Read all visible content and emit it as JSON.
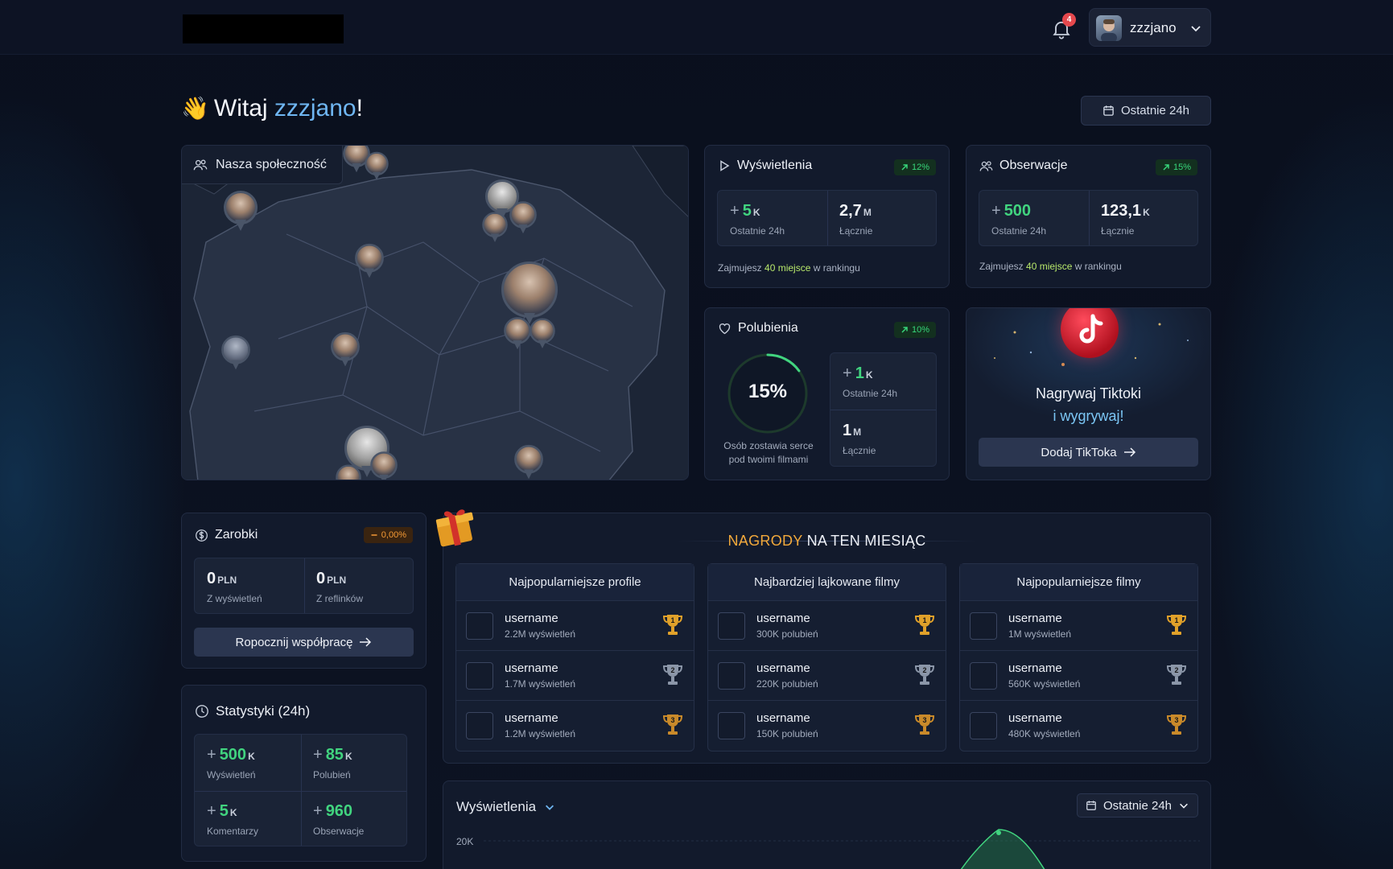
{
  "header": {
    "notification_count": "4",
    "user_name": "zzzjano"
  },
  "welcome": {
    "greeting": "Witaj",
    "name": "zzzjano",
    "suffix": "!",
    "emoji": "👋"
  },
  "range_button": "Ostatnie 24h",
  "community": {
    "title": "Nasza społeczność"
  },
  "views_card": {
    "title": "Wyświetlenia",
    "trend": "12%",
    "last24_value": "5",
    "last24_unit": "K",
    "last24_label": "Ostatnie 24h",
    "total_value": "2,7",
    "total_unit": "M",
    "total_label": "Łącznie",
    "rank_prefix": "Zajmujesz",
    "rank_place": "40 miejsce",
    "rank_suffix": "w rankingu"
  },
  "followers_card": {
    "title": "Obserwacje",
    "trend": "15%",
    "last24_value": "500",
    "last24_label": "Ostatnie 24h",
    "total_value": "123,1",
    "total_unit": "K",
    "total_label": "Łącznie",
    "rank_prefix": "Zajmujesz",
    "rank_place": "40 miejsce",
    "rank_suffix": "w rankingu"
  },
  "likes_card": {
    "title": "Polubienia",
    "trend": "10%",
    "ring_percent": "15%",
    "ring_fraction": 0.15,
    "ring_caption": "Osób zostawia serce pod twoimi filmami",
    "last24_value": "1",
    "last24_unit": "K",
    "last24_label": "Ostatnie 24h",
    "total_value": "1",
    "total_unit": "M",
    "total_label": "Łącznie"
  },
  "tiktok_card": {
    "line1": "Nagrywaj Tiktoki",
    "line2": "i wygrywaj!",
    "button": "Dodaj TikToka"
  },
  "earnings": {
    "title": "Zarobki",
    "trend": "0,00%",
    "views_value": "0",
    "views_unit": "PLN",
    "views_label": "Z wyświetleń",
    "reflinks_value": "0",
    "reflinks_unit": "PLN",
    "reflinks_label": "Z reflinków",
    "button": "Ropocznij współpracę"
  },
  "stats24": {
    "title": "Statystyki (24h)",
    "views_value": "500",
    "views_unit": "K",
    "views_label": "Wyświetleń",
    "likes_value": "85",
    "likes_unit": "K",
    "likes_label": "Polubień",
    "comments_value": "5",
    "comments_unit": "K",
    "comments_label": "Komentarzy",
    "followers_value": "960",
    "followers_label": "Obserwacje"
  },
  "prizes": {
    "title_highlight": "NAGRODY",
    "title_rest": "NA TEN MIESIĄC",
    "columns": [
      {
        "title": "Najpopularniejsze profile",
        "rows": [
          {
            "name": "username",
            "sub": "2.2M wyświetleń",
            "place": "1"
          },
          {
            "name": "username",
            "sub": "1.7M wyświetleń",
            "place": "2"
          },
          {
            "name": "username",
            "sub": "1.2M wyświetleń",
            "place": "3"
          }
        ]
      },
      {
        "title": "Najbardziej lajkowane filmy",
        "rows": [
          {
            "name": "username",
            "sub": "300K polubień",
            "place": "1"
          },
          {
            "name": "username",
            "sub": "220K polubień",
            "place": "2"
          },
          {
            "name": "username",
            "sub": "150K polubień",
            "place": "3"
          }
        ]
      },
      {
        "title": "Najpopularniejsze filmy",
        "rows": [
          {
            "name": "username",
            "sub": "1M wyświetleń",
            "place": "1"
          },
          {
            "name": "username",
            "sub": "560K wyświetleń",
            "place": "2"
          },
          {
            "name": "username",
            "sub": "480K wyświetleń",
            "place": "3"
          }
        ]
      }
    ]
  },
  "views_chart": {
    "title": "Wyświetlenia",
    "range": "Ostatnie 24h",
    "y_tick": "20K"
  },
  "colors": {
    "accent_green": "#41d47f",
    "accent_blue": "#6fb6f2",
    "accent_orange": "#f2a93b",
    "gold": "#e0a12a",
    "silver": "#8b96a8",
    "bronze": "#c98a2a"
  }
}
